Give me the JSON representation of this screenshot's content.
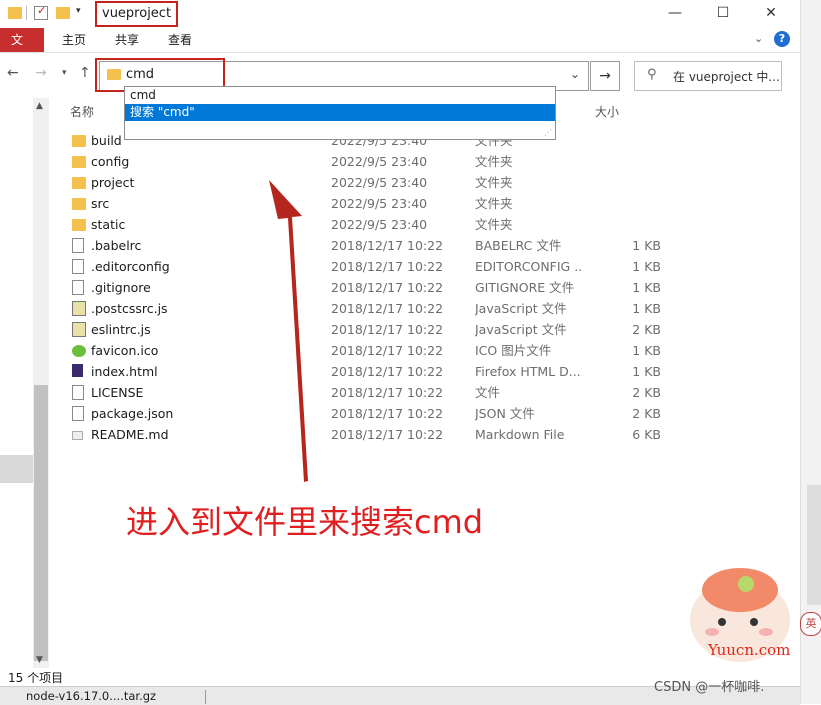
{
  "window": {
    "title": "vueproject",
    "controls": {
      "minimize": "—",
      "maximize": "☐",
      "close": "✕"
    }
  },
  "ribbon": {
    "tabs": [
      "文件",
      "主页",
      "共享",
      "查看"
    ]
  },
  "address": {
    "value": "cmd",
    "search_placeholder": "在 vueproject 中..."
  },
  "dropdown": {
    "items": [
      "cmd",
      "搜索 \"cmd\""
    ]
  },
  "columns": {
    "name": "名称",
    "size": "大小"
  },
  "files": [
    {
      "name": "build",
      "date": "2022/9/5 23:40",
      "type": "文件夹",
      "size": "",
      "icon": "folder-icon"
    },
    {
      "name": "config",
      "date": "2022/9/5 23:40",
      "type": "文件夹",
      "size": "",
      "icon": "folder-icon"
    },
    {
      "name": "project",
      "date": "2022/9/5 23:40",
      "type": "文件夹",
      "size": "",
      "icon": "folder-icon"
    },
    {
      "name": "src",
      "date": "2022/9/5 23:40",
      "type": "文件夹",
      "size": "",
      "icon": "folder-icon"
    },
    {
      "name": "static",
      "date": "2022/9/5 23:40",
      "type": "文件夹",
      "size": "",
      "icon": "folder-icon"
    },
    {
      "name": ".babelrc",
      "date": "2018/12/17 10:22",
      "type": "BABELRC 文件",
      "size": "1 KB",
      "icon": "file-icon"
    },
    {
      "name": ".editorconfig",
      "date": "2018/12/17 10:22",
      "type": "EDITORCONFIG ...",
      "size": "1 KB",
      "icon": "file-icon"
    },
    {
      "name": ".gitignore",
      "date": "2018/12/17 10:22",
      "type": "GITIGNORE 文件",
      "size": "1 KB",
      "icon": "file-icon"
    },
    {
      "name": ".postcssrc.js",
      "date": "2018/12/17 10:22",
      "type": "JavaScript 文件",
      "size": "1 KB",
      "icon": "js-file-icon"
    },
    {
      "name": "eslintrc.js",
      "date": "2018/12/17 10:22",
      "type": "JavaScript 文件",
      "size": "2 KB",
      "icon": "js-file-icon"
    },
    {
      "name": "favicon.ico",
      "date": "2018/12/17 10:22",
      "type": "ICO 图片文件",
      "size": "1 KB",
      "icon": "ico-file-icon"
    },
    {
      "name": "index.html",
      "date": "2018/12/17 10:22",
      "type": "Firefox HTML D...",
      "size": "1 KB",
      "icon": "html-file-icon"
    },
    {
      "name": "LICENSE",
      "date": "2018/12/17 10:22",
      "type": "文件",
      "size": "2 KB",
      "icon": "file-icon"
    },
    {
      "name": "package.json",
      "date": "2018/12/17 10:22",
      "type": "JSON 文件",
      "size": "2 KB",
      "icon": "file-icon"
    },
    {
      "name": "README.md",
      "date": "2018/12/17 10:22",
      "type": "Markdown File",
      "size": "6 KB",
      "icon": "md-file-icon"
    }
  ],
  "annotation": "进入到文件里来搜索cmd",
  "status": {
    "count": "15 个项目"
  },
  "taskbar": {
    "item": "node-v16.17.0....tar.gz"
  },
  "watermark": {
    "csdn": "CSDN @一杯咖啡.",
    "site": "Yuucn.com",
    "badge": "英"
  },
  "colors": {
    "accent": "#0078d7",
    "file_tab": "#c72e2e",
    "annotation": "#e02020"
  }
}
